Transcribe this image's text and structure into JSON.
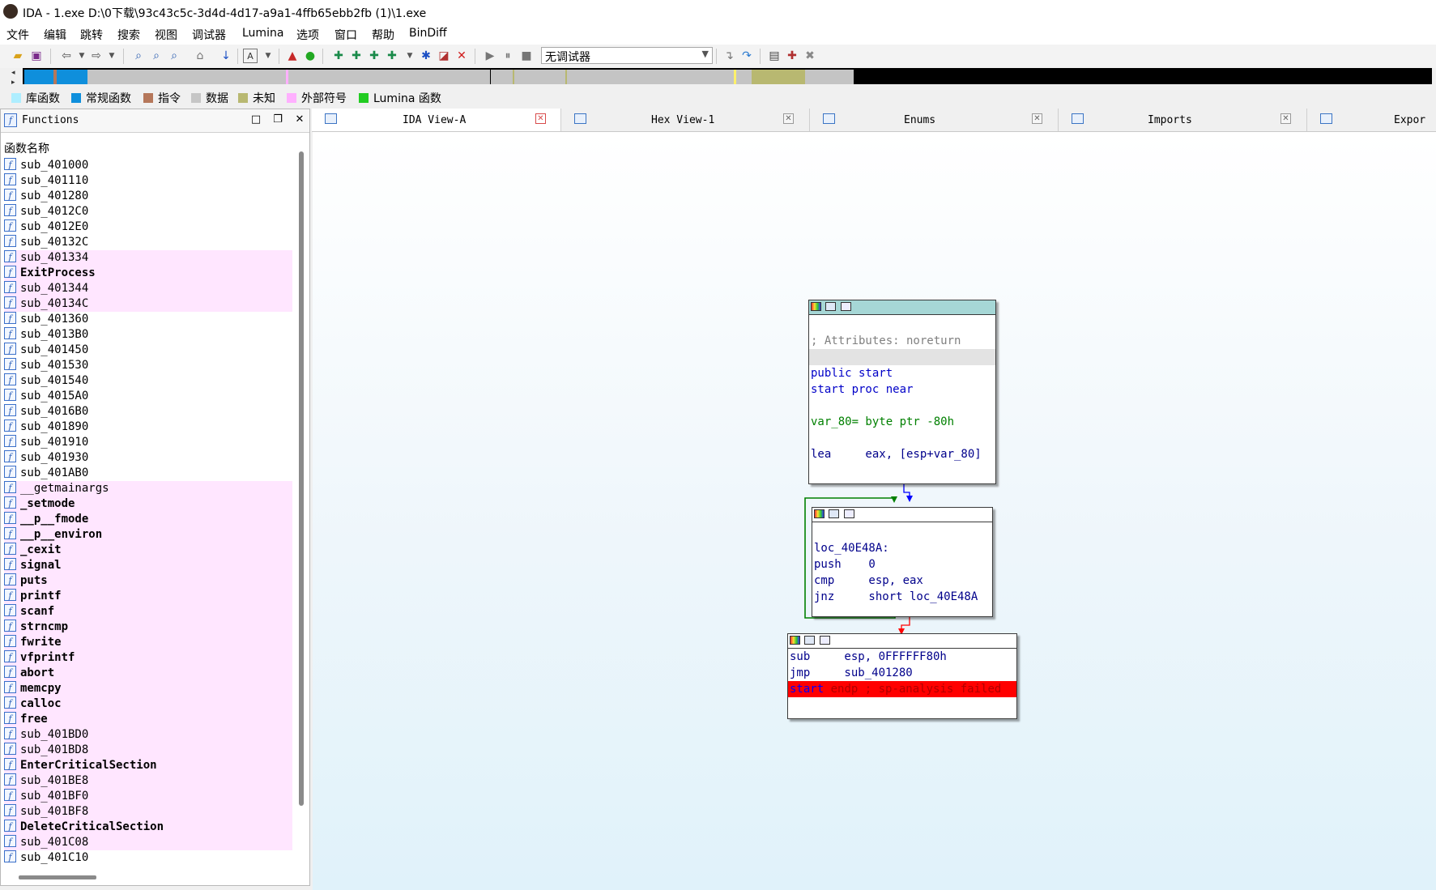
{
  "window": {
    "title": "IDA - 1.exe D:\\0下载\\93c43c5c-3d4d-4d17-a9a1-4ffb65ebb2fb (1)\\1.exe"
  },
  "menu": [
    "文件",
    "编辑",
    "跳转",
    "搜索",
    "视图",
    "调试器",
    "Lumina",
    "选项",
    "窗口",
    "帮助",
    "BinDiff"
  ],
  "toolbar": {
    "debugger_selected": "无调试器"
  },
  "legend": [
    {
      "label": "库函数",
      "color": "#aeeeff"
    },
    {
      "label": "常规函数",
      "color": "#0f8fdc"
    },
    {
      "label": "指令",
      "color": "#b5775a"
    },
    {
      "label": "数据",
      "color": "#c6c6c6"
    },
    {
      "label": "未知",
      "color": "#b8b871"
    },
    {
      "label": "外部符号",
      "color": "#ffb0ff"
    },
    {
      "label": "Lumina 函数",
      "color": "#22cc22"
    }
  ],
  "functions_panel": {
    "title": "Functions",
    "column_header": "函数名称",
    "items": [
      {
        "name": "sub_401000",
        "lib": false,
        "bold": false
      },
      {
        "name": "sub_401110",
        "lib": false,
        "bold": false
      },
      {
        "name": "sub_401280",
        "lib": false,
        "bold": false
      },
      {
        "name": "sub_4012C0",
        "lib": false,
        "bold": false
      },
      {
        "name": "sub_4012E0",
        "lib": false,
        "bold": false
      },
      {
        "name": "sub_40132C",
        "lib": false,
        "bold": false
      },
      {
        "name": "sub_401334",
        "lib": true,
        "bold": false
      },
      {
        "name": "ExitProcess",
        "lib": true,
        "bold": true
      },
      {
        "name": "sub_401344",
        "lib": true,
        "bold": false
      },
      {
        "name": "sub_40134C",
        "lib": true,
        "bold": false
      },
      {
        "name": "sub_401360",
        "lib": false,
        "bold": false
      },
      {
        "name": "sub_4013B0",
        "lib": false,
        "bold": false
      },
      {
        "name": "sub_401450",
        "lib": false,
        "bold": false
      },
      {
        "name": "sub_401530",
        "lib": false,
        "bold": false
      },
      {
        "name": "sub_401540",
        "lib": false,
        "bold": false
      },
      {
        "name": "sub_4015A0",
        "lib": false,
        "bold": false
      },
      {
        "name": "sub_4016B0",
        "lib": false,
        "bold": false
      },
      {
        "name": "sub_401890",
        "lib": false,
        "bold": false
      },
      {
        "name": "sub_401910",
        "lib": false,
        "bold": false
      },
      {
        "name": "sub_401930",
        "lib": false,
        "bold": false
      },
      {
        "name": "sub_401AB0",
        "lib": false,
        "bold": false
      },
      {
        "name": "__getmainargs",
        "lib": true,
        "bold": false
      },
      {
        "name": "_setmode",
        "lib": true,
        "bold": true
      },
      {
        "name": "__p__fmode",
        "lib": true,
        "bold": true
      },
      {
        "name": "__p__environ",
        "lib": true,
        "bold": true
      },
      {
        "name": "_cexit",
        "lib": true,
        "bold": true
      },
      {
        "name": "signal",
        "lib": true,
        "bold": true
      },
      {
        "name": "puts",
        "lib": true,
        "bold": true
      },
      {
        "name": "printf",
        "lib": true,
        "bold": true
      },
      {
        "name": "scanf",
        "lib": true,
        "bold": true
      },
      {
        "name": "strncmp",
        "lib": true,
        "bold": true
      },
      {
        "name": "fwrite",
        "lib": true,
        "bold": true
      },
      {
        "name": "vfprintf",
        "lib": true,
        "bold": true
      },
      {
        "name": "abort",
        "lib": true,
        "bold": true
      },
      {
        "name": "memcpy",
        "lib": true,
        "bold": true
      },
      {
        "name": "calloc",
        "lib": true,
        "bold": true
      },
      {
        "name": "free",
        "lib": true,
        "bold": true
      },
      {
        "name": "sub_401BD0",
        "lib": true,
        "bold": false
      },
      {
        "name": "sub_401BD8",
        "lib": true,
        "bold": false
      },
      {
        "name": "EnterCriticalSection",
        "lib": true,
        "bold": true
      },
      {
        "name": "sub_401BE8",
        "lib": true,
        "bold": false
      },
      {
        "name": "sub_401BF0",
        "lib": true,
        "bold": false
      },
      {
        "name": "sub_401BF8",
        "lib": true,
        "bold": false
      },
      {
        "name": "DeleteCriticalSection",
        "lib": true,
        "bold": true
      },
      {
        "name": "sub_401C08",
        "lib": true,
        "bold": false
      },
      {
        "name": "sub_401C10",
        "lib": false,
        "bold": false
      }
    ]
  },
  "tabs": [
    {
      "label": "IDA View-A",
      "active": true
    },
    {
      "label": "Hex View-1",
      "active": false
    },
    {
      "label": "Enums",
      "active": false
    },
    {
      "label": "Imports",
      "active": false
    },
    {
      "label": "Expor",
      "active": false
    }
  ],
  "graph": {
    "node1": {
      "comment": "; Attributes: noreturn",
      "public_start": "public start",
      "proc_decl": "start proc near",
      "var_line": "var_80= byte ptr -80h",
      "lea_line": "lea     eax, [esp+var_80]"
    },
    "node2": {
      "label": "loc_40E48A:",
      "push_line": "push    0",
      "cmp_line": "cmp     esp, eax",
      "jnz_line": "jnz     short loc_40E48A"
    },
    "node3": {
      "sub_line": "sub     esp, 0FFFFFF80h",
      "jmp_line": "jmp     sub_401280",
      "endp_start": "start",
      "endp_rest": " endp ; sp-analysis failed"
    }
  },
  "colors": {
    "lib_row_bg": "#ffe6ff",
    "node_header": "#a6d7d6",
    "edge_true": "#008000",
    "edge_false": "#ff0000",
    "edge_uncond": "#0000ff"
  }
}
